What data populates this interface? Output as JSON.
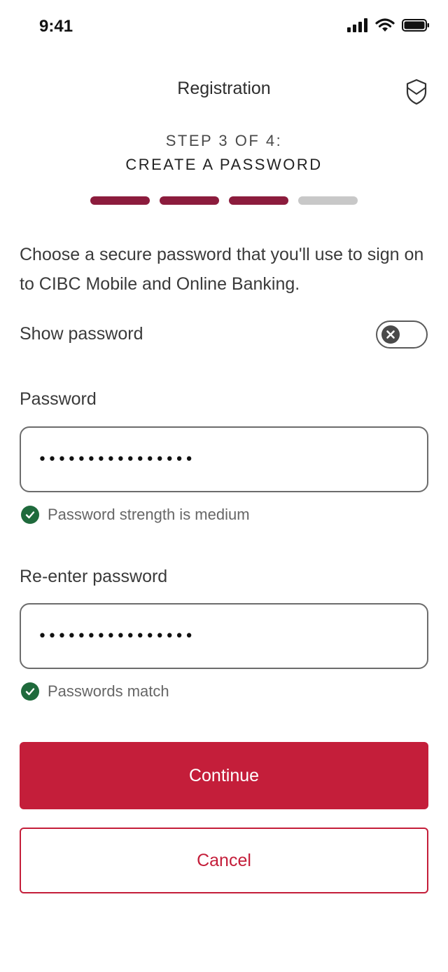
{
  "status_bar": {
    "time": "9:41"
  },
  "header": {
    "title": "Registration",
    "shield_icon": "shield-icon"
  },
  "step": {
    "line1": "STEP 3 OF 4:",
    "line2": "CREATE A PASSWORD",
    "current": 3,
    "total": 4
  },
  "intro_text": "Choose a secure password that you'll use to sign on to CIBC Mobile and Online Banking.",
  "show_password": {
    "label": "Show password",
    "enabled": false
  },
  "password": {
    "label": "Password",
    "value": "••••••••••••••••",
    "hint": "Password strength is medium"
  },
  "reenter_password": {
    "label": "Re-enter password",
    "value": "••••••••••••••••",
    "hint": "Passwords match"
  },
  "buttons": {
    "continue": "Continue",
    "cancel": "Cancel"
  },
  "colors": {
    "progress_active": "#8c1c3d",
    "progress_inactive": "#c8c8c8",
    "primary": "#c41e3a",
    "success": "#1f6a3c"
  }
}
